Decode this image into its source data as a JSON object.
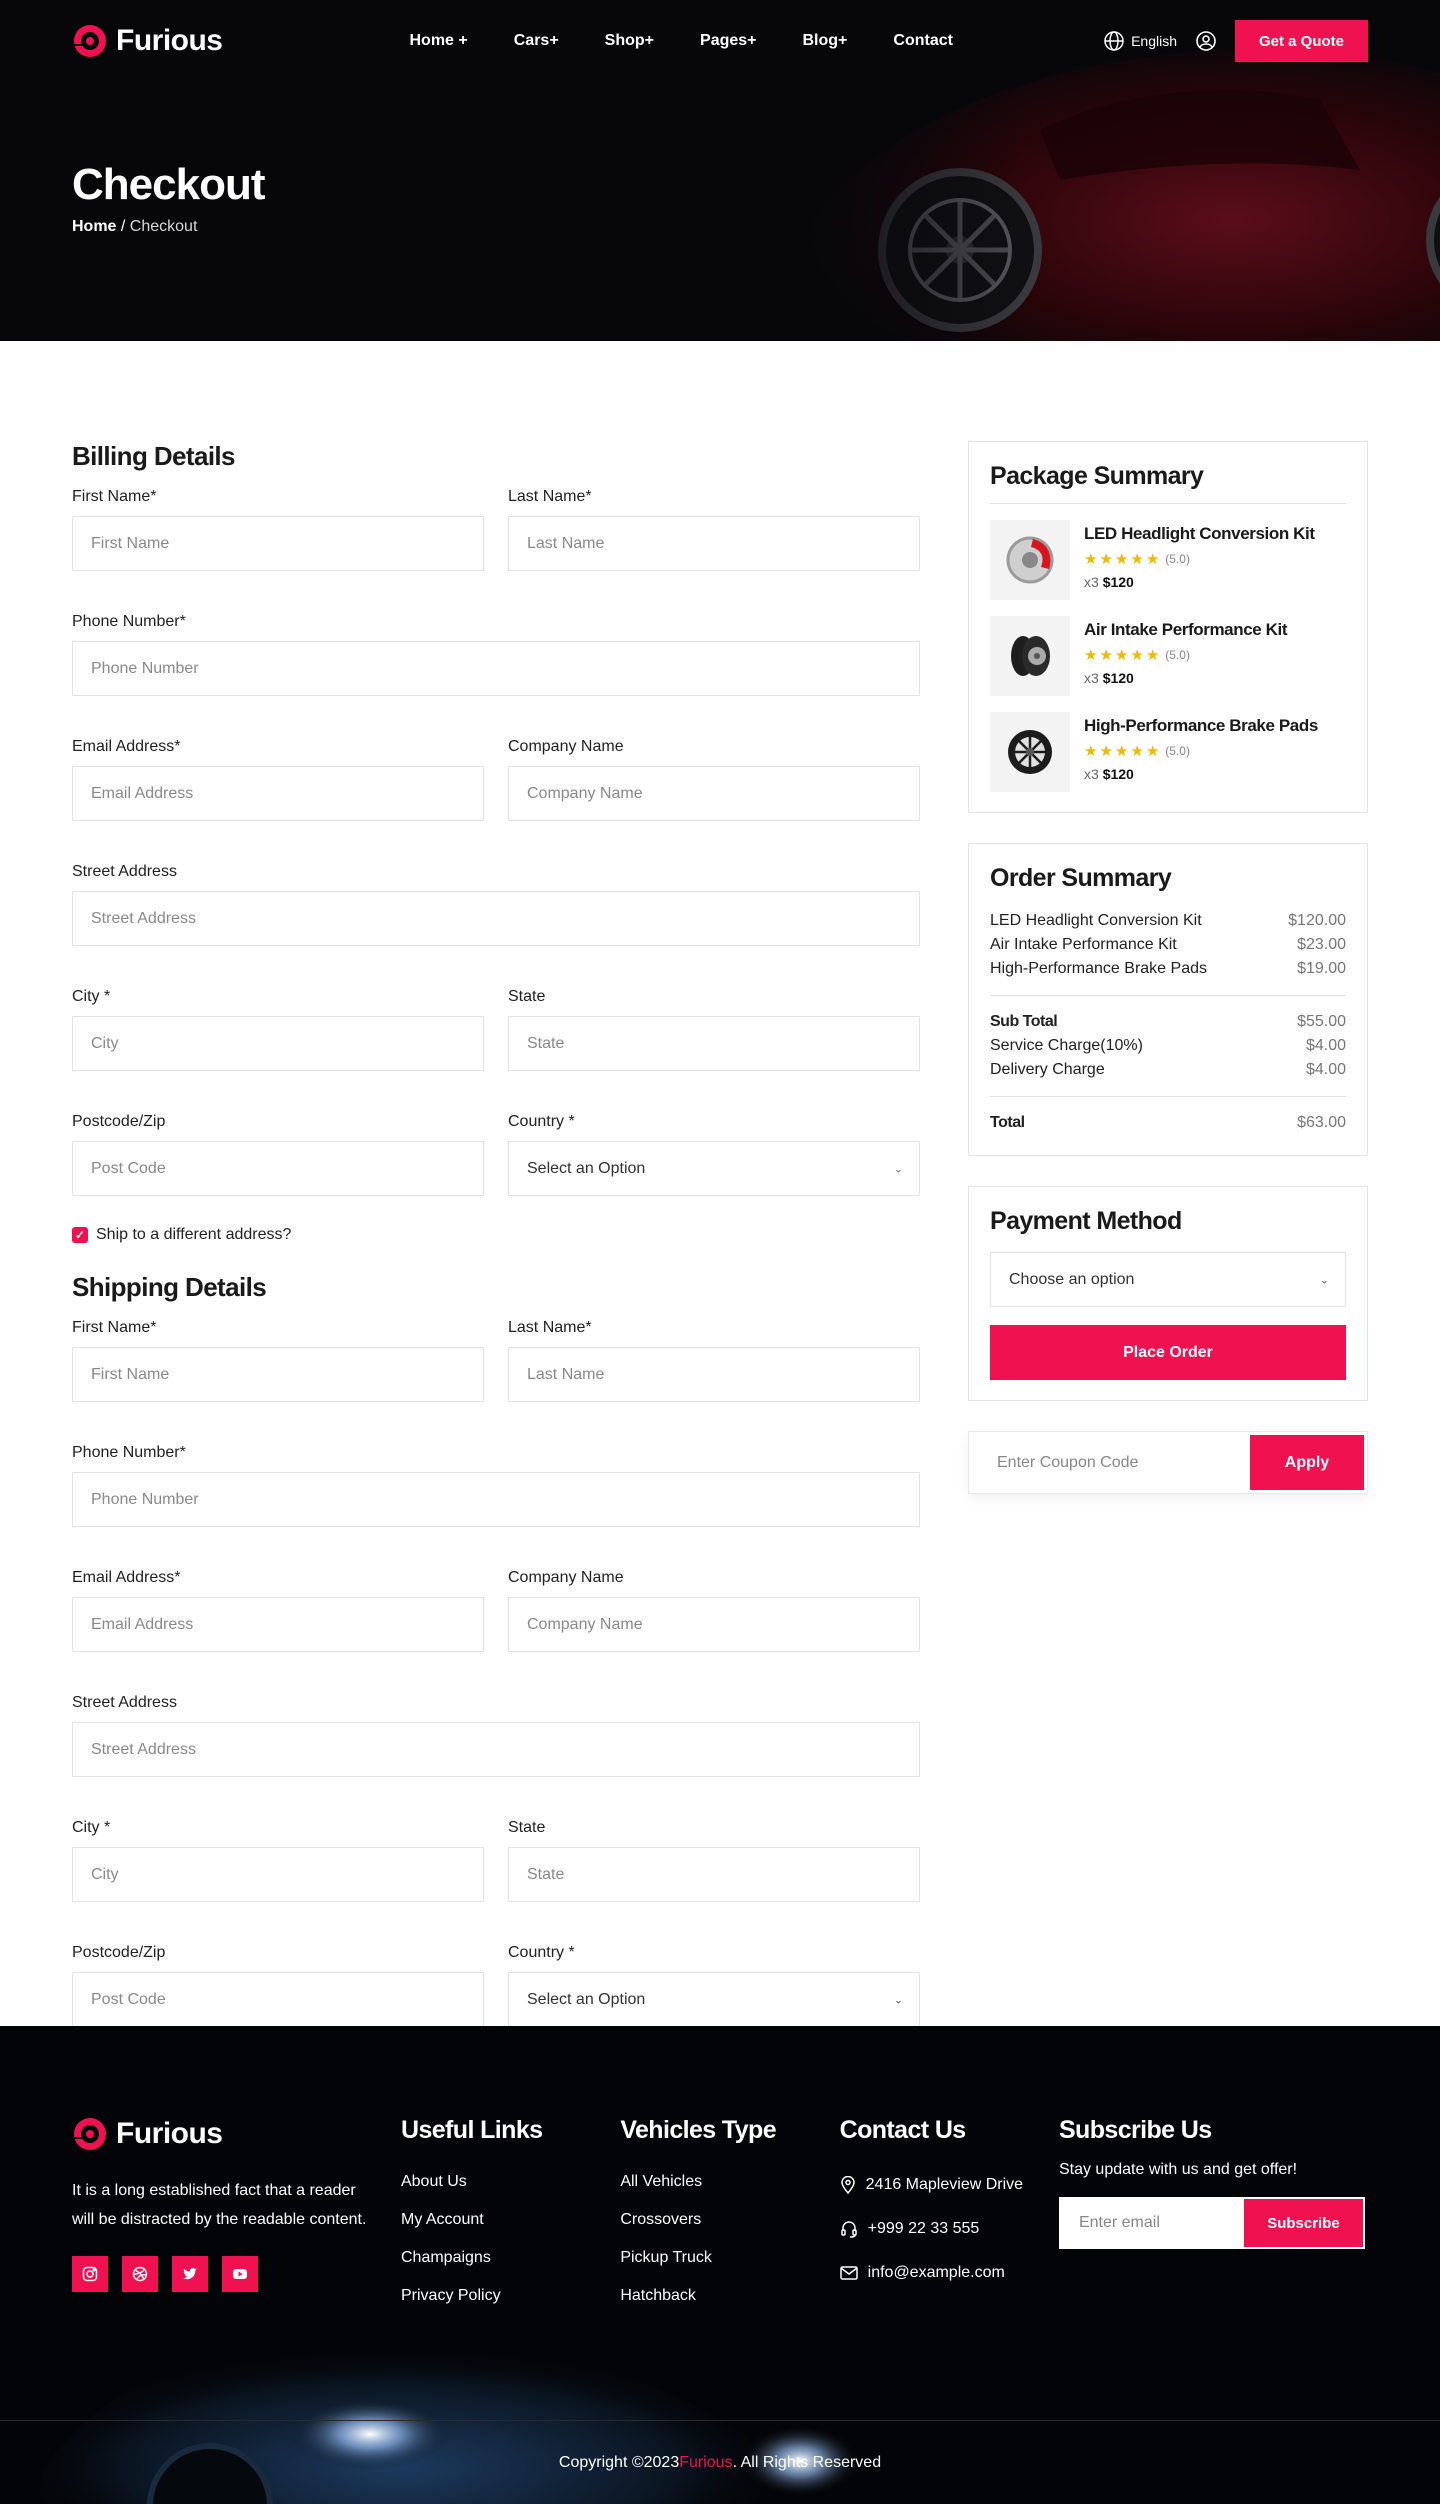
{
  "brand": {
    "name": "Furious",
    "accent": "#ef1150"
  },
  "nav": {
    "items": [
      "Home +",
      "Cars+",
      "Shop+",
      "Pages+",
      "Blog+",
      "Contact"
    ],
    "language": "English",
    "quote_label": "Get a Quote"
  },
  "hero": {
    "title": "Checkout",
    "breadcrumb_home": "Home",
    "breadcrumb_sep": " / ",
    "breadcrumb_current": "Checkout"
  },
  "billing": {
    "title": "Billing Details",
    "fields": {
      "first_name": {
        "label": "First Name*",
        "placeholder": "First Name"
      },
      "last_name": {
        "label": "Last Name*",
        "placeholder": "Last Name"
      },
      "phone": {
        "label": "Phone Number*",
        "placeholder": "Phone Number"
      },
      "email": {
        "label": "Email Address*",
        "placeholder": "Email Address"
      },
      "company": {
        "label": "Company Name",
        "placeholder": "Company Name"
      },
      "street": {
        "label": "Street Address",
        "placeholder": "Street Address"
      },
      "city": {
        "label": "City *",
        "placeholder": "City"
      },
      "state": {
        "label": "State",
        "placeholder": "State"
      },
      "postcode": {
        "label": "Postcode/Zip",
        "placeholder": "Post Code"
      },
      "country": {
        "label": "Country *",
        "value": "Select an Option"
      }
    }
  },
  "ship_toggle": {
    "label": "Ship to a different address?",
    "checked": true
  },
  "shipping": {
    "title": "Shipping Details",
    "fields": {
      "first_name": {
        "label": "First Name*",
        "placeholder": "First Name"
      },
      "last_name": {
        "label": "Last Name*",
        "placeholder": "Last Name"
      },
      "phone": {
        "label": "Phone Number*",
        "placeholder": "Phone Number"
      },
      "email": {
        "label": "Email Address*",
        "placeholder": "Email Address"
      },
      "company": {
        "label": "Company Name",
        "placeholder": "Company Name"
      },
      "street": {
        "label": "Street Address",
        "placeholder": "Street Address"
      },
      "city": {
        "label": "City *",
        "placeholder": "City"
      },
      "state": {
        "label": "State",
        "placeholder": "State"
      },
      "postcode": {
        "label": "Postcode/Zip",
        "placeholder": "Post Code"
      },
      "country": {
        "label": "Country *",
        "value": "Select an Option"
      }
    }
  },
  "package_summary": {
    "title": "Package Summary",
    "items": [
      {
        "name": "LED Headlight Conversion Kit",
        "rating": "(5.0)",
        "qty": "x3",
        "price": "$120",
        "icon": "brake-caliper-icon"
      },
      {
        "name": "Air Intake Performance Kit",
        "rating": "(5.0)",
        "qty": "x3",
        "price": "$120",
        "icon": "tire-icon"
      },
      {
        "name": "High-Performance Brake Pads",
        "rating": "(5.0)",
        "qty": "x3",
        "price": "$120",
        "icon": "wheel-rim-icon"
      }
    ]
  },
  "order_summary": {
    "title": "Order Summary",
    "items": [
      {
        "label": "LED Headlight Conversion Kit",
        "amount": "$120.00"
      },
      {
        "label": "Air Intake Performance Kit",
        "amount": "$23.00"
      },
      {
        "label": "High-Performance Brake Pads",
        "amount": "$19.00"
      }
    ],
    "subtotal": {
      "label": "Sub Total",
      "amount": "$55.00"
    },
    "service": {
      "label": "Service Charge(10%)",
      "amount": "$4.00"
    },
    "delivery": {
      "label": "Delivery Charge",
      "amount": "$4.00"
    },
    "total": {
      "label": "Total",
      "amount": "$63.00"
    }
  },
  "payment": {
    "title": "Payment Method",
    "select_value": "Choose an option",
    "place_order": "Place Order"
  },
  "coupon": {
    "placeholder": "Enter Coupon Code",
    "apply": "Apply"
  },
  "footer": {
    "description": "It is a long established fact that a reader will be distracted by the readable content.",
    "useful_links": {
      "title": "Useful Links",
      "items": [
        "About Us",
        "My Account",
        "Champaigns",
        "Privacy Policy"
      ]
    },
    "vehicles": {
      "title": "Vehicles Type",
      "items": [
        "All Vehicles",
        "Crossovers",
        "Pickup Truck",
        "Hatchback"
      ]
    },
    "contact": {
      "title": "Contact Us",
      "address": "2416 Mapleview Drive",
      "phone": "+999 22 33 555",
      "email": "info@example.com"
    },
    "subscribe": {
      "title": "Subscribe Us",
      "text": "Stay update with us and get offer!",
      "placeholder": "Enter email",
      "button": "Subscribe"
    },
    "copyright_pre": "Copyright ©2023 ",
    "copyright_brand": "Furious",
    "copyright_post": ". All Rights Reserved"
  }
}
